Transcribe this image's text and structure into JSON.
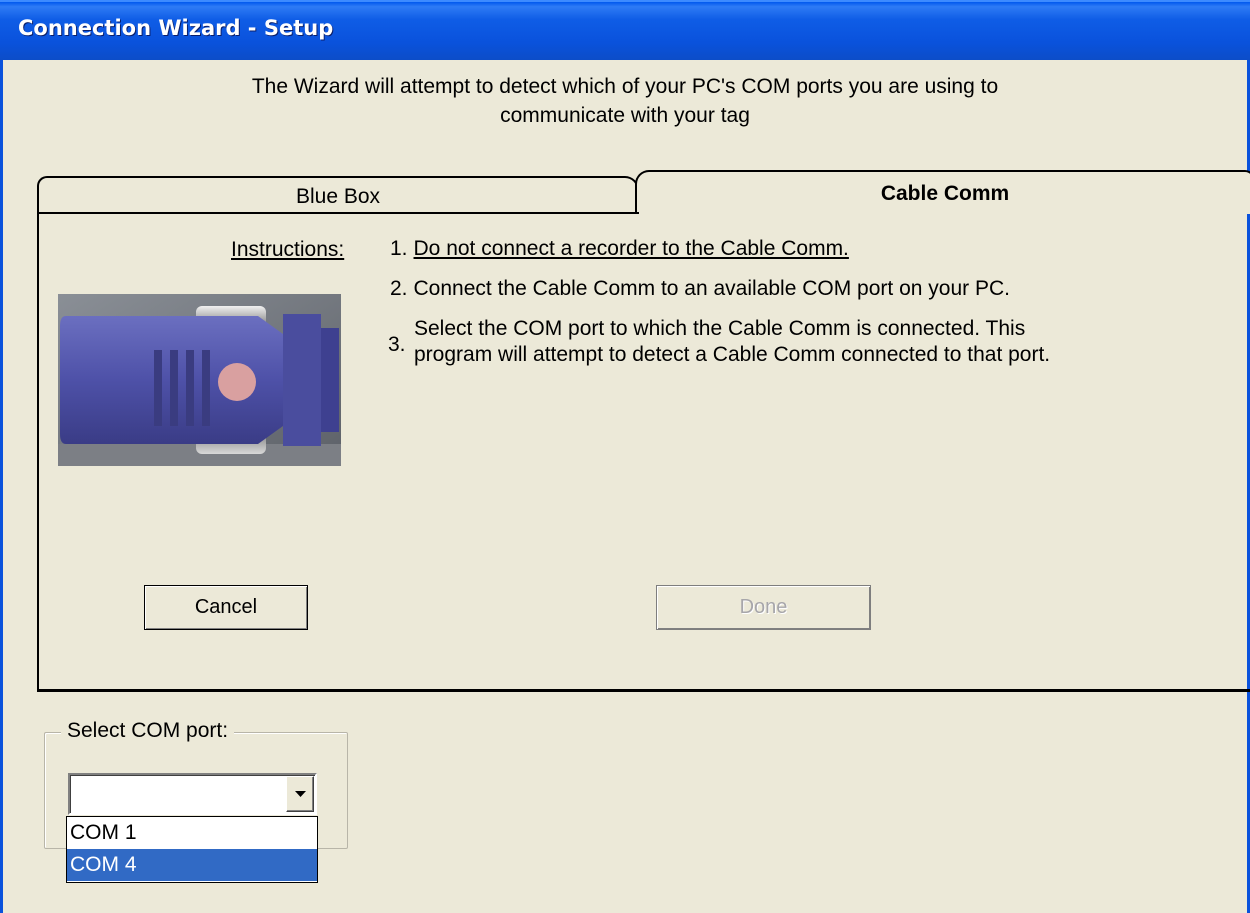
{
  "window": {
    "title": "Connection Wizard - Setup"
  },
  "intro": {
    "line1": "The Wizard will attempt to detect which of your PC's COM ports you are using to",
    "line2": "communicate with your tag"
  },
  "tabs": [
    {
      "label": "Blue Box",
      "selected": false
    },
    {
      "label": "Cable Comm",
      "selected": true
    }
  ],
  "instructions": {
    "label": "Instructions:",
    "steps": [
      {
        "num": "1.",
        "text": "Do not connect a recorder to the Cable Comm."
      },
      {
        "num": "2.",
        "text": "Connect the Cable Comm to an available COM port on your PC."
      },
      {
        "num": "3.",
        "line1": "Select the COM port to which the Cable Comm is connected.  This",
        "line2": "program will attempt to detect a Cable Comm connected to that port."
      }
    ]
  },
  "buttons": {
    "cancel": "Cancel",
    "done": "Done"
  },
  "com_port": {
    "legend": "Select COM port:",
    "value": "",
    "options": [
      {
        "label": "COM 1",
        "highlighted": false
      },
      {
        "label": "COM 4",
        "highlighted": true
      }
    ]
  },
  "colors": {
    "titlebar": "#0A52DC",
    "window_bg": "#ECE9D8",
    "selection": "#316AC5",
    "indicator": "#D9A0A0"
  }
}
